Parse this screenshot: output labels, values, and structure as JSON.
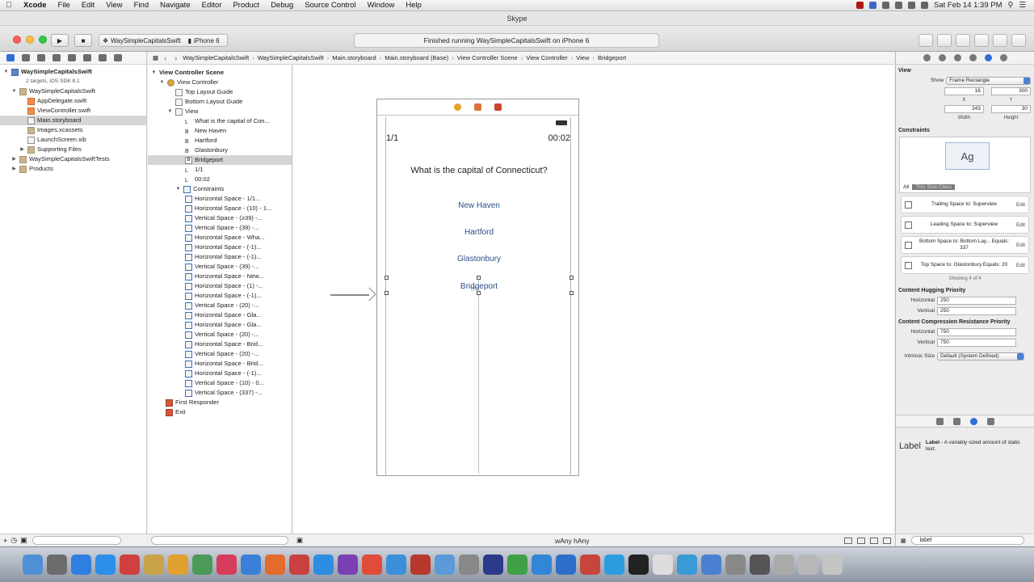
{
  "menubar": {
    "app": "Xcode",
    "items": [
      "File",
      "Edit",
      "View",
      "Find",
      "Navigate",
      "Editor",
      "Product",
      "Debug",
      "Source Control",
      "Window",
      "Help"
    ],
    "clock": "Sat Feb 14  1:39 PM"
  },
  "window_title": "Skype",
  "toolbar": {
    "scheme": "WaySimpleCapitalsSwift",
    "device": "iPhone 6",
    "activity": "Finished running WaySimpleCapitalsSwift on iPhone 6"
  },
  "jumpbar": [
    "WaySimpleCapitalsSwift",
    "WaySimpleCapitalsSwift",
    "Main.storyboard",
    "Main.storyboard (Base)",
    "View Controller Scene",
    "View Controller",
    "View",
    "Bridgeport"
  ],
  "navigator": {
    "project": "WaySimpleCapitalsSwift",
    "project_sub": "2 targets, iOS SDK 8.1",
    "group": "WaySimpleCapitalsSwift",
    "files": [
      "AppDelegate.swift",
      "ViewController.swift",
      "Main.storyboard",
      "Images.xcassets",
      "LaunchScreen.xib",
      "Supporting Files"
    ],
    "tests": "WaySimpleCapitalsSwiftTests",
    "products": "Products"
  },
  "outline": {
    "scene": "View Controller Scene",
    "controller": "View Controller",
    "top_guide": "Top Layout Guide",
    "bottom_guide": "Bottom Layout Guide",
    "view": "View",
    "subviews": [
      "What is the capital of Con...",
      "New Haven",
      "Hartford",
      "Glastonbury",
      "Bridgeport",
      "1/1",
      "00:02"
    ],
    "constraints_label": "Constraints",
    "constraints": [
      "Horizontal Space - 1/1...",
      "Horizontal Space - (10) - 1...",
      "Vertical Space - (≥39) -...",
      "Vertical Space - (39) -...",
      "Horizontal Space - Wha...",
      "Horizontal Space - (-1)...",
      "Horizontal Space - (-1)...",
      "Vertical Space - (39) -...",
      "Horizontal Space - New...",
      "Horizontal Space - (1) -...",
      "Horizontal Space - (-1)...",
      "Vertical Space - (20) -...",
      "Horizontal Space - Gla...",
      "Horizontal Space - Gla...",
      "Vertical Space - (20) -...",
      "Horizontal Space - Brid...",
      "Vertical Space - (20) -...",
      "Horizontal Space - Brid...",
      "Horizontal Space - (-1)...",
      "Vertical Space - (10) - 0...",
      "Vertical Space - (337) -..."
    ],
    "first_responder": "First Responder",
    "exit": "Exit"
  },
  "scene": {
    "counter": "1/1",
    "timer": "00:02",
    "question": "What is the capital of Connecticut?",
    "answers": [
      "New Haven",
      "Hartford",
      "Glastonbury",
      "Bridgeport"
    ]
  },
  "canvas_footer": {
    "size_class": "wAny hAny"
  },
  "inspector": {
    "view_title": "View",
    "show_label": "Show",
    "show_value": "Frame Rectangle",
    "x_value": "16",
    "y_value": "300",
    "x_label": "X",
    "y_label": "Y",
    "width_value": "343",
    "height_value": "30",
    "width_label": "Width",
    "height_label": "Height",
    "constraints_title": "Constraints",
    "constraint_tabs": [
      "All",
      "This Size Class"
    ],
    "constraint_rows": [
      {
        "text": "Trailing Space to: Superview",
        "edit": "Edit"
      },
      {
        "text": "Leading Space to: Superview",
        "edit": "Edit"
      },
      {
        "text": "Bottom Space to: Bottom Lay... Equals: 337",
        "edit": "Edit"
      },
      {
        "text": "Top Space to: Glastonbury Equals: 20",
        "edit": "Edit"
      }
    ],
    "showing": "Showing 4 of 4",
    "hugging_title": "Content Hugging Priority",
    "horizontal_label": "Horizontal",
    "vertical_label": "Vertical",
    "hugging_h": "250",
    "hugging_v": "250",
    "compression_title": "Content Compression Resistance Priority",
    "compression_h": "750",
    "compression_v": "750",
    "intrinsic_label": "Intrinsic Size",
    "intrinsic_value": "Default (System Defined)",
    "library_big": "Label",
    "library_name": "Label",
    "library_desc": " - A variably sized amount of static text.",
    "filter_text": "label"
  }
}
